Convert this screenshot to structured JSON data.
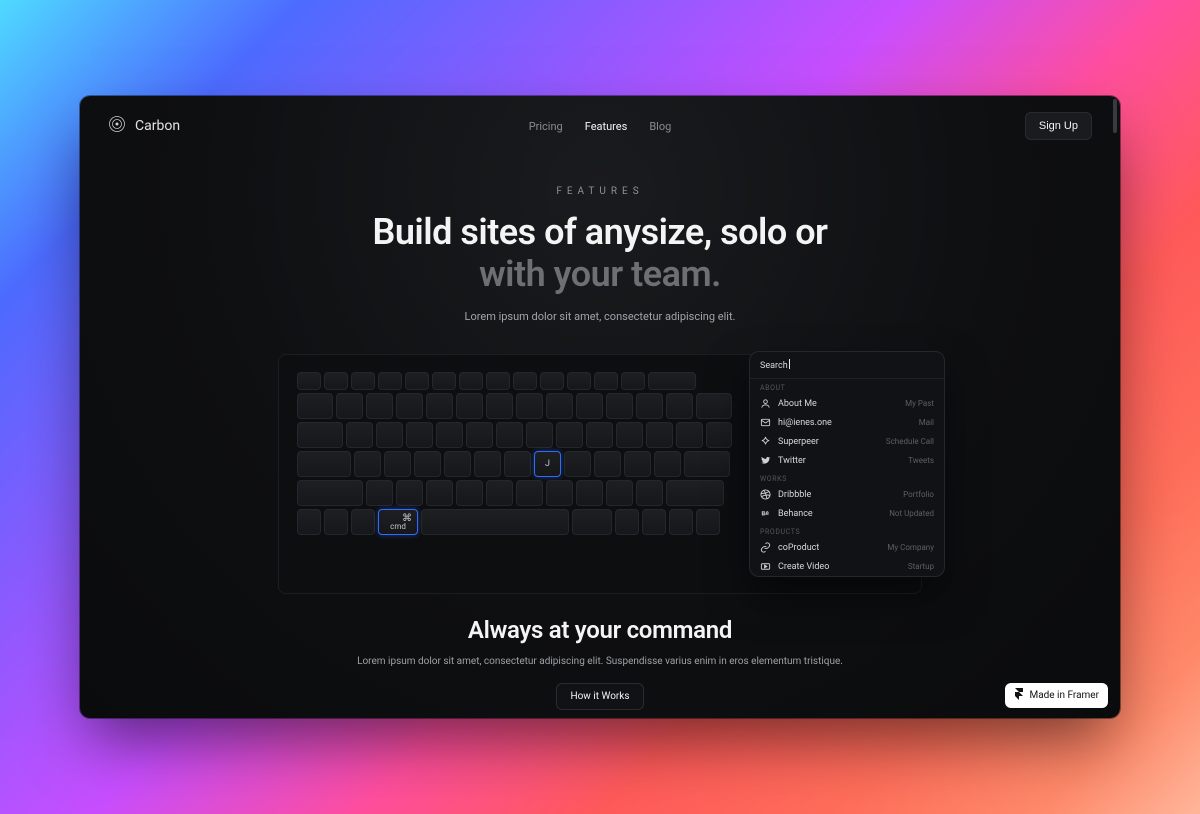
{
  "nav": {
    "brand": "Carbon",
    "links": [
      "Pricing",
      "Features",
      "Blog"
    ],
    "active": 1,
    "signup": "Sign Up"
  },
  "hero": {
    "eyebrow": "FEATURES",
    "title_line1": "Build sites of anysize, solo or",
    "title_line2": "with your team.",
    "subtitle": "Lorem ipsum dolor sit amet, consectetur adipiscing elit."
  },
  "keyboard": {
    "highlighted": [
      {
        "label": "J"
      },
      {
        "symbol": "⌘",
        "label": "cmd"
      }
    ]
  },
  "palette": {
    "search_placeholder": "Search",
    "sections": [
      {
        "label": "ABOUT",
        "items": [
          {
            "icon": "user-icon",
            "label": "About Me",
            "meta": "My Past"
          },
          {
            "icon": "mail-icon",
            "label": "hi@ienes.one",
            "meta": "Mail"
          },
          {
            "icon": "spark-icon",
            "label": "Superpeer",
            "meta": "Schedule Call"
          },
          {
            "icon": "twitter-icon",
            "label": "Twitter",
            "meta": "Tweets"
          }
        ]
      },
      {
        "label": "WORKS",
        "items": [
          {
            "icon": "dribbble-icon",
            "label": "Dribbble",
            "meta": "Portfolio"
          },
          {
            "icon": "behance-icon",
            "label": "Behance",
            "meta": "Not Updated"
          }
        ]
      },
      {
        "label": "PRODUCTS",
        "items": [
          {
            "icon": "link-icon",
            "label": "coProduct",
            "meta": "My Company"
          },
          {
            "icon": "clip-icon",
            "label": "Create Video",
            "meta": "Startup"
          }
        ]
      }
    ]
  },
  "foot": {
    "title": "Always at your command",
    "subtitle": "Lorem ipsum dolor sit amet, consectetur adipiscing elit. Suspendisse varius enim in eros elementum tristique.",
    "button": "How it Works"
  },
  "badge": {
    "label": "Made in Framer"
  }
}
